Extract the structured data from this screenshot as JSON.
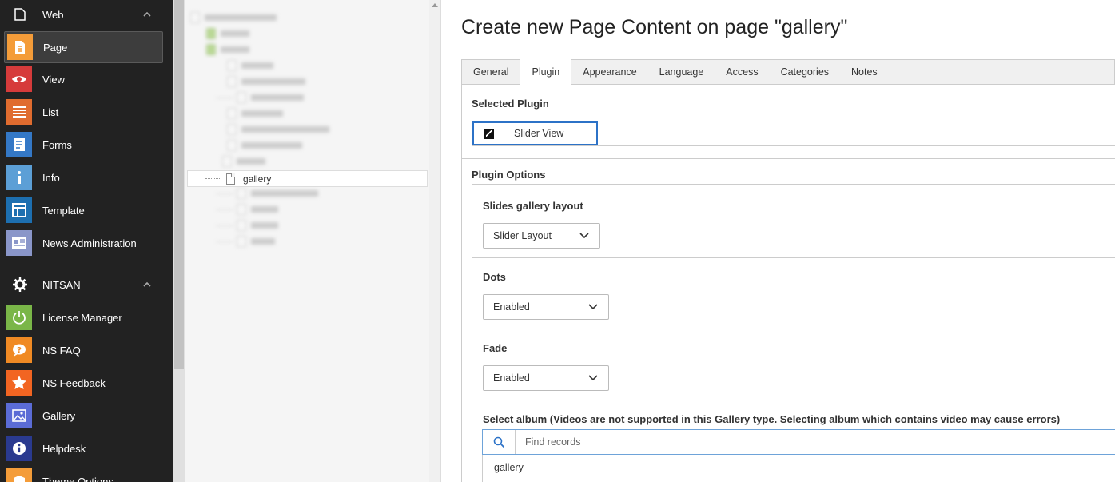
{
  "module_menu": {
    "groups": [
      {
        "label": "Web",
        "icon": "file-icon"
      },
      {
        "label": "NITSAN",
        "icon": "gear-icon"
      }
    ],
    "web_items": [
      {
        "label": "Page",
        "icon": "page-icon",
        "color": "#f49c39",
        "active": true
      },
      {
        "label": "View",
        "icon": "eye-icon",
        "color": "#d63b3b"
      },
      {
        "label": "List",
        "icon": "list-icon",
        "color": "#e06c2f"
      },
      {
        "label": "Forms",
        "icon": "form-icon",
        "color": "#3478c6"
      },
      {
        "label": "Info",
        "icon": "info-icon",
        "color": "#5c9fd6"
      },
      {
        "label": "Template",
        "icon": "template-icon",
        "color": "#1d6fb0"
      },
      {
        "label": "News Administration",
        "icon": "newspaper-icon",
        "color": "#8a96c9"
      }
    ],
    "nitsan_items": [
      {
        "label": "License Manager",
        "icon": "power-icon",
        "color": "#7ab648"
      },
      {
        "label": "NS FAQ",
        "icon": "faq-icon",
        "color": "#f08a24"
      },
      {
        "label": "NS Feedback",
        "icon": "star-icon",
        "color": "#f26522"
      },
      {
        "label": "Gallery",
        "icon": "image-icon",
        "color": "#5b6cd6"
      },
      {
        "label": "Helpdesk",
        "icon": "helpdesk-icon",
        "color": "#2a3a8f"
      },
      {
        "label": "Theme Options",
        "icon": "box-icon",
        "color": "#f49c39"
      }
    ]
  },
  "page_tree": {
    "selected_label": "gallery"
  },
  "main": {
    "title": "Create new Page Content on page \"gallery\"",
    "tabs": [
      {
        "label": "General"
      },
      {
        "label": "Plugin",
        "active": true
      },
      {
        "label": "Appearance"
      },
      {
        "label": "Language"
      },
      {
        "label": "Access"
      },
      {
        "label": "Categories"
      },
      {
        "label": "Notes"
      }
    ],
    "selected_plugin_heading": "Selected Plugin",
    "selected_plugin_value": "Slider View",
    "plugin_options_heading": "Plugin Options",
    "options": {
      "layout_label": "Slides gallery layout",
      "layout_value": "Slider Layout",
      "dots_label": "Dots",
      "dots_value": "Enabled",
      "fade_label": "Fade",
      "fade_value": "Enabled",
      "album_label": "Select album (Videos are not supported in this Gallery type. Selecting album which contains video may cause errors)",
      "find_placeholder": "Find records",
      "record_item": "gallery"
    }
  },
  "colors": {
    "sidebar_bg": "#222222",
    "focus_blue": "#2c72c7"
  }
}
